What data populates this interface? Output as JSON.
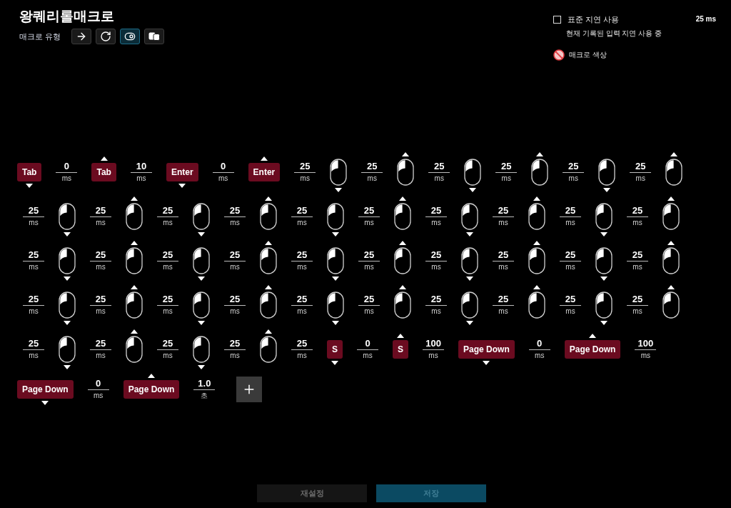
{
  "title": "왕퀘리롤매크로",
  "macro_type": {
    "label": "매크로 유형",
    "options": [
      {
        "kind": "sequence",
        "selected": false
      },
      {
        "kind": "repeat",
        "selected": false
      },
      {
        "kind": "toggle",
        "selected": true
      },
      {
        "kind": "hold",
        "selected": false
      }
    ]
  },
  "delay_settings": {
    "checkbox": {
      "label": "표준 지연 사용",
      "checked": false
    },
    "value": "25 ms",
    "note": "현재 기록된 입력 지연 사용 중"
  },
  "macro_color": {
    "label": "매크로 색상"
  },
  "events": [
    {
      "kind": "key",
      "label": "Tab",
      "released": false
    },
    {
      "kind": "delay",
      "value": "0",
      "unit": "ms"
    },
    {
      "kind": "key",
      "label": "Tab",
      "released": true
    },
    {
      "kind": "delay",
      "value": "10",
      "unit": "ms"
    },
    {
      "kind": "key",
      "label": "Enter",
      "released": false
    },
    {
      "kind": "delay",
      "value": "0",
      "unit": "ms"
    },
    {
      "kind": "key",
      "label": "Enter",
      "released": true
    },
    {
      "kind": "delay",
      "value": "25",
      "unit": "ms"
    },
    {
      "kind": "mouse",
      "released": false
    },
    {
      "kind": "delay",
      "value": "25",
      "unit": "ms"
    },
    {
      "kind": "mouse",
      "released": true
    },
    {
      "kind": "delay",
      "value": "25",
      "unit": "ms"
    },
    {
      "kind": "mouse",
      "released": false
    },
    {
      "kind": "delay",
      "value": "25",
      "unit": "ms"
    },
    {
      "kind": "mouse",
      "released": true
    },
    {
      "kind": "delay",
      "value": "25",
      "unit": "ms"
    },
    {
      "kind": "mouse",
      "released": false
    },
    {
      "kind": "delay",
      "value": "25",
      "unit": "ms"
    },
    {
      "kind": "mouse",
      "released": true
    },
    {
      "kind": "delay",
      "value": "25",
      "unit": "ms"
    },
    {
      "kind": "mouse",
      "released": false
    },
    {
      "kind": "delay",
      "value": "25",
      "unit": "ms"
    },
    {
      "kind": "mouse",
      "released": true
    },
    {
      "kind": "delay",
      "value": "25",
      "unit": "ms"
    },
    {
      "kind": "mouse",
      "released": false
    },
    {
      "kind": "delay",
      "value": "25",
      "unit": "ms"
    },
    {
      "kind": "mouse",
      "released": true
    },
    {
      "kind": "delay",
      "value": "25",
      "unit": "ms"
    },
    {
      "kind": "mouse",
      "released": false
    },
    {
      "kind": "delay",
      "value": "25",
      "unit": "ms"
    },
    {
      "kind": "mouse",
      "released": true
    },
    {
      "kind": "delay",
      "value": "25",
      "unit": "ms"
    },
    {
      "kind": "mouse",
      "released": false
    },
    {
      "kind": "delay",
      "value": "25",
      "unit": "ms"
    },
    {
      "kind": "mouse",
      "released": true
    },
    {
      "kind": "delay",
      "value": "25",
      "unit": "ms"
    },
    {
      "kind": "mouse",
      "released": false
    },
    {
      "kind": "delay",
      "value": "25",
      "unit": "ms"
    },
    {
      "kind": "mouse",
      "released": true
    },
    {
      "kind": "delay",
      "value": "25",
      "unit": "ms"
    },
    {
      "kind": "mouse",
      "released": false
    },
    {
      "kind": "delay",
      "value": "25",
      "unit": "ms"
    },
    {
      "kind": "mouse",
      "released": true
    },
    {
      "kind": "delay",
      "value": "25",
      "unit": "ms"
    },
    {
      "kind": "mouse",
      "released": false
    },
    {
      "kind": "delay",
      "value": "25",
      "unit": "ms"
    },
    {
      "kind": "mouse",
      "released": true
    },
    {
      "kind": "delay",
      "value": "25",
      "unit": "ms"
    },
    {
      "kind": "mouse",
      "released": false
    },
    {
      "kind": "delay",
      "value": "25",
      "unit": "ms"
    },
    {
      "kind": "mouse",
      "released": true
    },
    {
      "kind": "delay",
      "value": "25",
      "unit": "ms"
    },
    {
      "kind": "mouse",
      "released": false
    },
    {
      "kind": "delay",
      "value": "25",
      "unit": "ms"
    },
    {
      "kind": "mouse",
      "released": true
    },
    {
      "kind": "delay",
      "value": "25",
      "unit": "ms"
    },
    {
      "kind": "mouse",
      "released": false
    },
    {
      "kind": "delay",
      "value": "25",
      "unit": "ms"
    },
    {
      "kind": "mouse",
      "released": true
    },
    {
      "kind": "delay",
      "value": "25",
      "unit": "ms"
    },
    {
      "kind": "mouse",
      "released": false
    },
    {
      "kind": "delay",
      "value": "25",
      "unit": "ms"
    },
    {
      "kind": "mouse",
      "released": true
    },
    {
      "kind": "delay",
      "value": "25",
      "unit": "ms"
    },
    {
      "kind": "mouse",
      "released": false
    },
    {
      "kind": "delay",
      "value": "25",
      "unit": "ms"
    },
    {
      "kind": "mouse",
      "released": true
    },
    {
      "kind": "delay",
      "value": "25",
      "unit": "ms"
    },
    {
      "kind": "mouse",
      "released": false
    },
    {
      "kind": "delay",
      "value": "25",
      "unit": "ms"
    },
    {
      "kind": "mouse",
      "released": true
    },
    {
      "kind": "delay",
      "value": "25",
      "unit": "ms"
    },
    {
      "kind": "mouse",
      "released": false
    },
    {
      "kind": "delay",
      "value": "25",
      "unit": "ms"
    },
    {
      "kind": "mouse",
      "released": true
    },
    {
      "kind": "delay",
      "value": "25",
      "unit": "ms"
    },
    {
      "kind": "mouse",
      "released": false
    },
    {
      "kind": "delay",
      "value": "25",
      "unit": "ms"
    },
    {
      "kind": "mouse",
      "released": true
    },
    {
      "kind": "delay",
      "value": "25",
      "unit": "ms"
    },
    {
      "kind": "mouse",
      "released": false
    },
    {
      "kind": "delay",
      "value": "25",
      "unit": "ms"
    },
    {
      "kind": "mouse",
      "released": true
    },
    {
      "kind": "delay",
      "value": "25",
      "unit": "ms"
    },
    {
      "kind": "mouse",
      "released": false
    },
    {
      "kind": "delay",
      "value": "25",
      "unit": "ms"
    },
    {
      "kind": "mouse",
      "released": true
    },
    {
      "kind": "delay",
      "value": "25",
      "unit": "ms"
    },
    {
      "kind": "key",
      "label": "S",
      "released": false
    },
    {
      "kind": "delay",
      "value": "0",
      "unit": "ms"
    },
    {
      "kind": "key",
      "label": "S",
      "released": true
    },
    {
      "kind": "delay",
      "value": "100",
      "unit": "ms"
    },
    {
      "kind": "key",
      "label": "Page Down",
      "released": false
    },
    {
      "kind": "delay",
      "value": "0",
      "unit": "ms"
    },
    {
      "kind": "key",
      "label": "Page Down",
      "released": true
    },
    {
      "kind": "delay",
      "value": "100",
      "unit": "ms"
    },
    {
      "kind": "key",
      "label": "Page Down",
      "released": false
    },
    {
      "kind": "delay",
      "value": "0",
      "unit": "ms"
    },
    {
      "kind": "key",
      "label": "Page Down",
      "released": true
    },
    {
      "kind": "delay",
      "value": "1.0",
      "unit": "초"
    }
  ],
  "buttons": [
    {
      "kind": "reset",
      "label": "재설정",
      "disabled": true
    },
    {
      "kind": "save",
      "label": "저장",
      "disabled": true
    }
  ]
}
